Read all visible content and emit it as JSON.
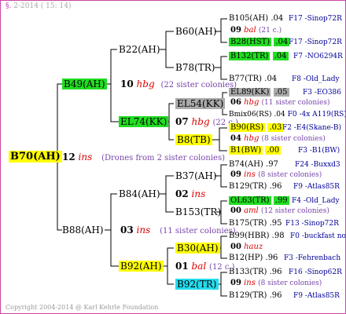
{
  "header": {
    "mark": "§.",
    "date": "2-2014 ( 15: 14)"
  },
  "footer": "Copyright 2004-2014 @ Karl Kehrle Foundation",
  "root": {
    "label": "B70(AH)",
    "year": "12",
    "mating": "ins",
    "note": "(Drones from 2 sister colonies)"
  },
  "l1": [
    {
      "label": "B49(AH)",
      "year": "10",
      "mating": "hbg",
      "note": "(22 sister colonies)"
    },
    {
      "label": "B88(AH)",
      "year": "03",
      "mating": "ins",
      "note": "(11 sister colonies)"
    }
  ],
  "l2": [
    {
      "label": "B22(AH)"
    },
    {
      "label": "EL74(KK)",
      "year": "07",
      "mating": "hbg",
      "note": "(22 c.)"
    },
    {
      "label": "B84(AH)",
      "year": "02",
      "mating": "ins"
    },
    {
      "label": "B92(AH)",
      "year": "01",
      "mating": "bal",
      "note": "(12 c.)"
    }
  ],
  "l3": [
    {
      "label": "B60(AH)",
      "year": "09",
      "mating": "bal",
      "note": "(21 c.)"
    },
    {
      "label": "B78(TR)"
    },
    {
      "label": "EL54(KK)",
      "year": "06",
      "mating": "hbg",
      "note": "(11 sister colonies)"
    },
    {
      "label": "B8(TB)",
      "year": "04",
      "mating": "hbg",
      "note": "(8 sister colonies)"
    },
    {
      "label": "B37(AH)",
      "year": "09",
      "mating": "ins",
      "note": "(8 sister colonies)"
    },
    {
      "label": "B153(TR)",
      "year": "00",
      "mating": "aml",
      "note": "(12 sister colonies)"
    },
    {
      "label": "B30(AH)",
      "year": "00",
      "mating": "hauz"
    },
    {
      "label": "B92(TR)",
      "year": "09",
      "mating": "ins",
      "note": "(8 sister colonies)"
    }
  ],
  "l4": [
    {
      "label": "B105(AH)",
      "val": ".04",
      "info": "F17 -Sinop72R"
    },
    {
      "label": "B28(HST)",
      "val": ".04",
      "info": "F17 -Sinop72R"
    },
    {
      "label": "B132(TR)",
      "val": ".04",
      "info": "F7 -NO6294R"
    },
    {
      "label": "B77(TR)",
      "val": ".04",
      "info": "F8 -Old_Lady"
    },
    {
      "label": "EL89(KK)",
      "val": ".05",
      "info": "F3 -EO386"
    },
    {
      "label": "Bmix06(RS)",
      "val": ".04",
      "info": "F0 -4x A119(RS)"
    },
    {
      "label": "B90(RS)",
      "val": ".03",
      "info": "F2 -E4(Skane-B)"
    },
    {
      "label": "B1(BW)",
      "val": ".00",
      "info": "F3 -B1(BW)"
    },
    {
      "label": "B74(AH)",
      "val": ".97",
      "info": "F24 -Buxxd3"
    },
    {
      "label": "B129(TR)",
      "val": ".96",
      "info": "F9 -Atlas85R"
    },
    {
      "label": "OL63(TR)",
      "val": ".99",
      "info": "F4 -Old_Lady"
    },
    {
      "label": "B175(TR)",
      "val": ".95",
      "info": "F13 -Sinop72R"
    },
    {
      "label": "B99(HBR)",
      "val": ".98",
      "info": "F0 -buckfast not"
    },
    {
      "label": "B12(HP)",
      "val": ".96",
      "info": "F3 -Fehrenbach"
    },
    {
      "label": "B133(TR)",
      "val": ".96",
      "info": "F16 -Sinop62R"
    },
    {
      "label": "B129(TR)",
      "val": ".96",
      "info": "F9 -Atlas85R"
    }
  ],
  "colors": {
    "frame": "#cc44aa",
    "line": "#000000",
    "green": "#22dd22",
    "yellow": "#ffff00",
    "gray": "#aaaaaa",
    "cyan": "#22ddee",
    "mating": "#dd0000",
    "info": "#000099",
    "note": "#7744aa"
  }
}
